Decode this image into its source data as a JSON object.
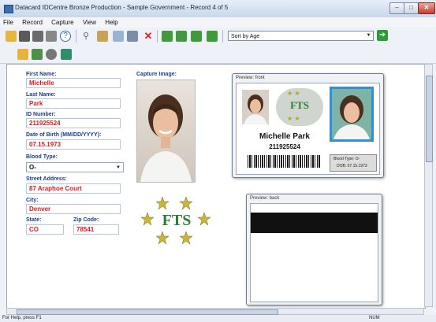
{
  "window": {
    "title": "Datacard IDCentre Bronze Production - Sample Government - Record 4 of 5",
    "minimize": "–",
    "maximize": "□",
    "close": "✕"
  },
  "menu": [
    "File",
    "Record",
    "Capture",
    "View",
    "Help"
  ],
  "toolbar": {
    "sort_value": "Sort by Age",
    "icons_row1": [
      "open-icon",
      "person-icon",
      "people-icon",
      "camera-icon",
      "help-icon",
      "search-icon",
      "filter-icon",
      "trash-bin-icon",
      "save-icon",
      "delete-icon",
      "first-record-icon",
      "previous-record-icon",
      "next-record-icon",
      "last-record-icon"
    ],
    "icons_row2": [
      "new-record-icon",
      "edit-fields-icon",
      "capture-icon",
      "print-icon"
    ]
  },
  "form": {
    "first_name_label": "First Name:",
    "first_name": "Michelle",
    "last_name_label": "Last Name:",
    "last_name": "Park",
    "id_label": "ID Number:",
    "id_number": "211925524",
    "dob_label": "Date of Birth (MM/DD/YYYY):",
    "dob": "07.15.1973",
    "blood_label": "Blood Type:",
    "blood_type": "O-",
    "street_label": "Street Address:",
    "street": "87 Araphoe Court",
    "city_label": "City:",
    "city": "Denver",
    "state_label": "State:",
    "state": "CO",
    "zip_label": "Zip Code:",
    "zip": "78541"
  },
  "capture": {
    "label": "Capture Image:",
    "logo_text": "FTS"
  },
  "preview_front": {
    "label": "Preview: front",
    "logo_text": "FTS",
    "name": "Michelle Park",
    "id": "211925524",
    "blood": "Blood Type: O-",
    "dob": "DOB: 07.15.1973"
  },
  "preview_back": {
    "label": "Preview: back"
  },
  "status": {
    "help": "For Help, press F1",
    "num": "NUM"
  },
  "colors": {
    "label_blue": "#1a3d8f",
    "value_red": "#d11f1f",
    "fts_green": "#2e7d32",
    "star_gold": "#b8a12a"
  }
}
